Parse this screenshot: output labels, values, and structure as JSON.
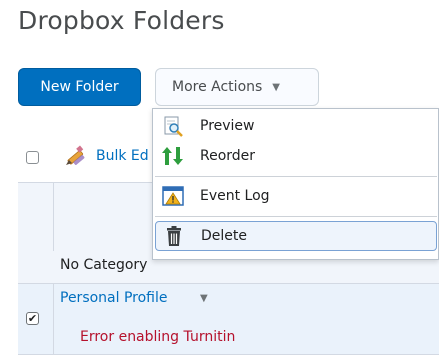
{
  "page": {
    "title": "Dropbox Folders"
  },
  "toolbar": {
    "new_folder_label": "New Folder",
    "more_actions_label": "More Actions",
    "bulk_edit_label": "Bulk Ed"
  },
  "more_actions_menu": {
    "items": [
      {
        "label": "Preview",
        "icon": "magnifier-page-icon"
      },
      {
        "label": "Reorder",
        "icon": "reorder-arrows-icon"
      },
      {
        "label": "Event Log",
        "icon": "warning-log-icon"
      },
      {
        "label": "Delete",
        "icon": "trash-icon",
        "highlighted": true
      }
    ]
  },
  "table": {
    "category_label": "No Category",
    "rows": [
      {
        "name": "Personal Profile",
        "checked": true,
        "error": "Error enabling Turnitin"
      }
    ]
  },
  "colors": {
    "accent": "#006fbf",
    "error": "#b5112c",
    "header_bg": "#f1f5fb",
    "selected_row_bg": "#eaf2fb"
  }
}
